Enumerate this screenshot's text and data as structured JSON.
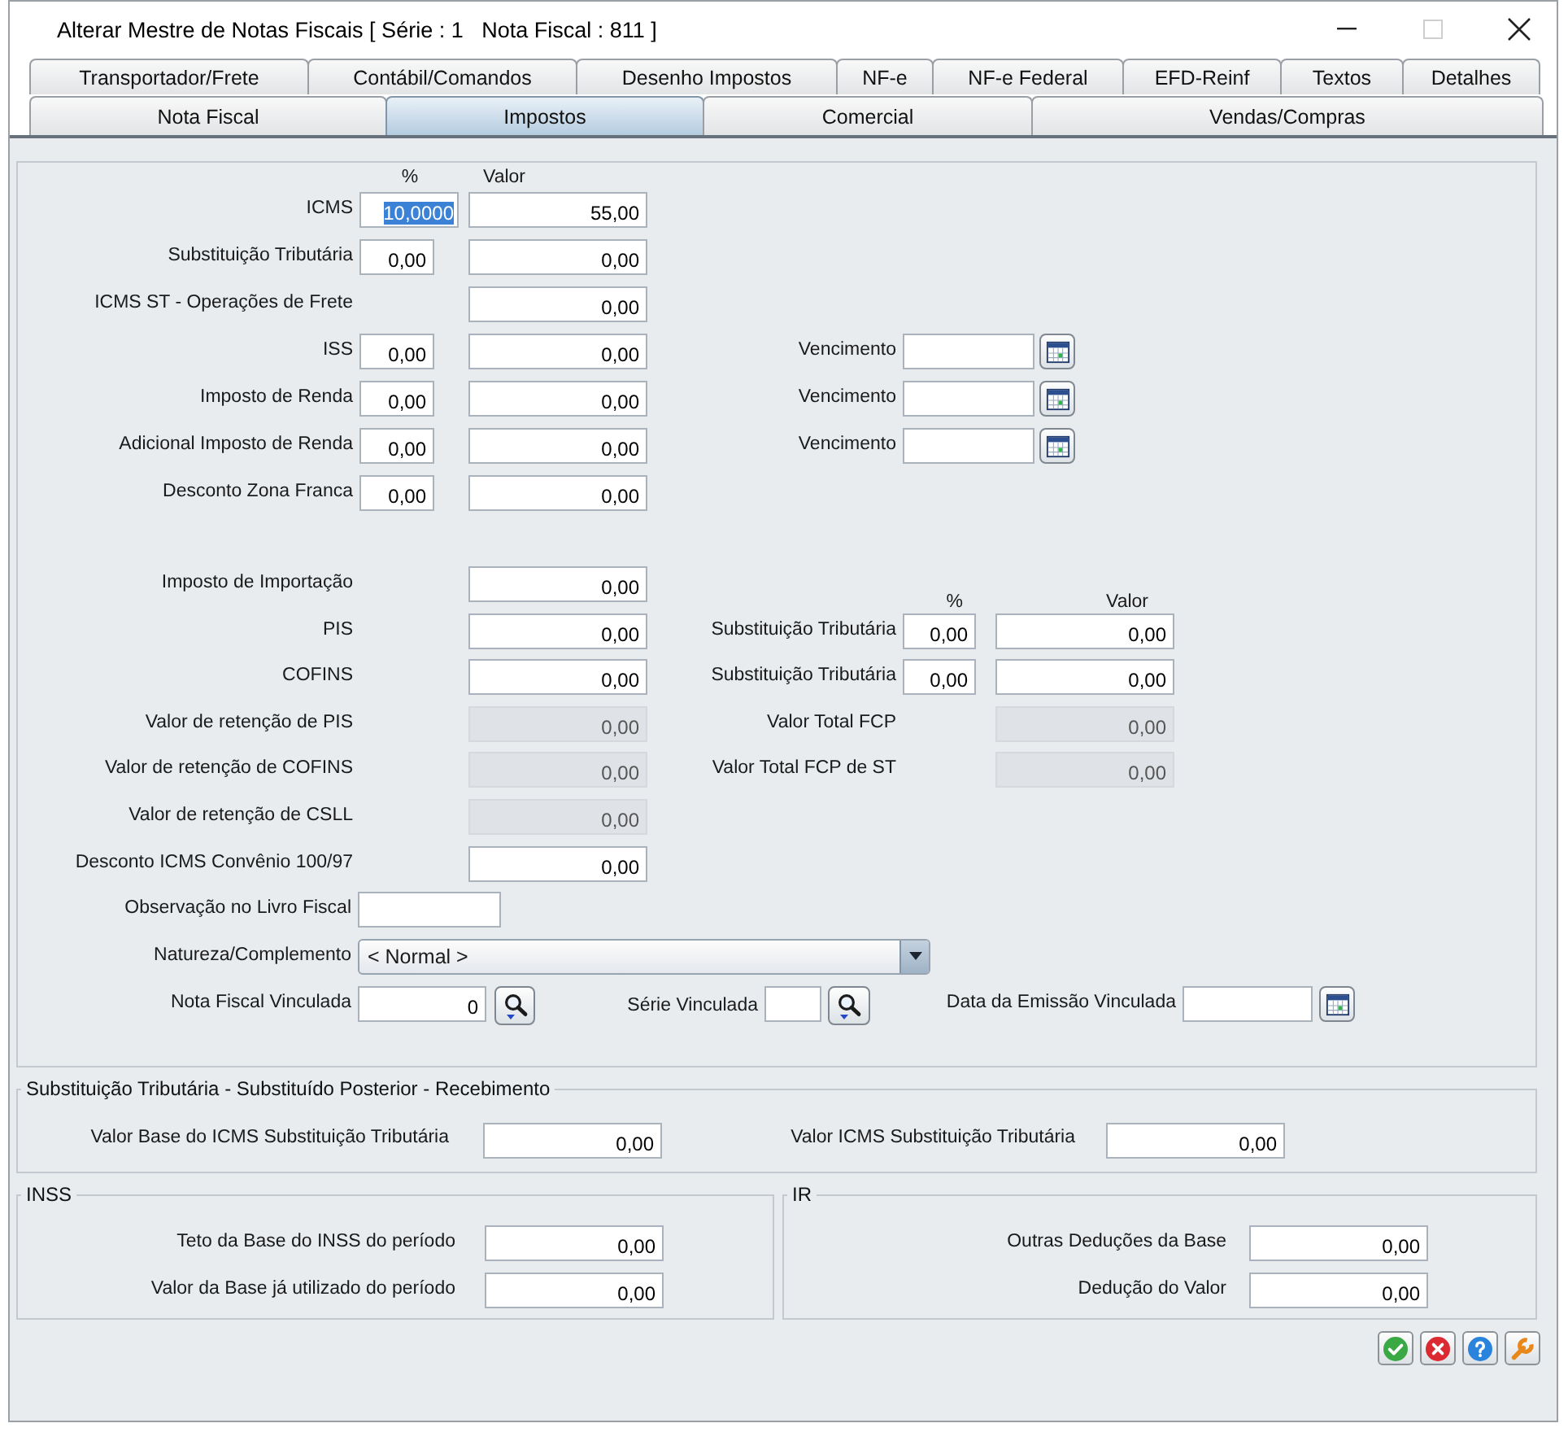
{
  "window": {
    "title": "Alterar Mestre de Notas Fiscais [ Série : 1   Nota Fiscal : 811 ]",
    "maximize_disabled": true
  },
  "tabs_top_row": [
    {
      "label": "Transportador/Frete",
      "selected": false
    },
    {
      "label": "Contábil/Comandos",
      "selected": false
    },
    {
      "label": "Desenho Impostos",
      "selected": false
    },
    {
      "label": "NF-e",
      "selected": false
    },
    {
      "label": "NF-e Federal",
      "selected": false
    },
    {
      "label": "EFD-Reinf",
      "selected": false
    },
    {
      "label": "Textos",
      "selected": false
    },
    {
      "label": "Detalhes",
      "selected": false
    }
  ],
  "tabs_bottom_row": [
    {
      "label": "Nota Fiscal",
      "selected": false
    },
    {
      "label": "Impostos",
      "selected": true
    },
    {
      "label": "Comercial",
      "selected": false
    },
    {
      "label": "Vendas/Compras",
      "selected": false
    }
  ],
  "tax_rates": {
    "percent_header": "%",
    "value_header": "Valor",
    "rows": [
      {
        "label": "ICMS",
        "percent": "10,0000",
        "percent_focused": true,
        "value": "55,00"
      },
      {
        "label": "Substituição Tributária",
        "percent": "0,00",
        "percent_focused": false,
        "value": "0,00"
      },
      {
        "label": "ICMS ST - Operações de Frete",
        "value": "0,00"
      },
      {
        "label": "ISS",
        "percent": "0,00",
        "percent_focused": false,
        "value": "0,00",
        "due_label": "Vencimento"
      },
      {
        "label": "Imposto de Renda",
        "percent": "0,00",
        "percent_focused": false,
        "value": "0,00",
        "due_label": "Vencimento"
      },
      {
        "label": "Adicional Imposto de Renda",
        "percent": "0,00",
        "percent_focused": false,
        "value": "0,00",
        "due_label": "Vencimento"
      },
      {
        "label": "Desconto Zona Franca",
        "percent": "0,00",
        "percent_focused": false,
        "value": "0,00"
      }
    ]
  },
  "other_taxes": [
    {
      "label": "Imposto de Importação",
      "value": "0,00",
      "disabled": false
    },
    {
      "label": "PIS",
      "value": "0,00",
      "disabled": false
    },
    {
      "label": "COFINS",
      "value": "0,00",
      "disabled": false
    },
    {
      "label": "Valor de retenção de PIS",
      "value": "0,00",
      "disabled": true
    },
    {
      "label": "Valor de retenção de COFINS",
      "value": "0,00",
      "disabled": true
    },
    {
      "label": "Valor de retenção de CSLL",
      "value": "0,00",
      "disabled": true
    },
    {
      "label": "Desconto ICMS Convênio 100/97",
      "value": "0,00",
      "disabled": false
    }
  ],
  "tax_substitution": {
    "percent_header": "%",
    "value_header": "Valor",
    "rows": [
      {
        "label": "Substituição Tributária",
        "percent": "0,00",
        "value": "0,00",
        "disabled": false
      },
      {
        "label": "Substituição Tributária",
        "percent": "0,00",
        "value": "0,00",
        "disabled": false
      },
      {
        "label": "Valor Total FCP",
        "value": "0,00",
        "disabled": true
      },
      {
        "label": "Valor Total FCP de ST",
        "value": "0,00",
        "disabled": true
      }
    ]
  },
  "fiscal_book_note": {
    "label": "Observação no Livro Fiscal"
  },
  "nature": {
    "label": "Natureza/Complemento",
    "value": "< Normal >"
  },
  "linked": [
    {
      "kind": "search",
      "label": "Nota Fiscal Vinculada",
      "value": "0"
    },
    {
      "kind": "search",
      "label": "Série Vinculada"
    },
    {
      "kind": "date",
      "label": "Data da Emissão Vinculada"
    }
  ],
  "st_later_receipt": {
    "title": "Substituição Tributária - Substituído Posterior - Recebimento",
    "fields": [
      {
        "label": "Valor Base do ICMS Substituição Tributária",
        "value": "0,00"
      },
      {
        "label": "Valor ICMS Substituição Tributária",
        "value": "0,00"
      }
    ]
  },
  "inss": {
    "title": "INSS",
    "fields": [
      {
        "label": "Teto da Base do INSS do período",
        "value": "0,00"
      },
      {
        "label": "Valor da Base já utilizado do período",
        "value": "0,00"
      }
    ]
  },
  "ir": {
    "title": "IR",
    "fields": [
      {
        "label": "Outras Deduções da Base",
        "value": "0,00"
      },
      {
        "label": "Dedução do Valor",
        "value": "0,00"
      }
    ]
  }
}
